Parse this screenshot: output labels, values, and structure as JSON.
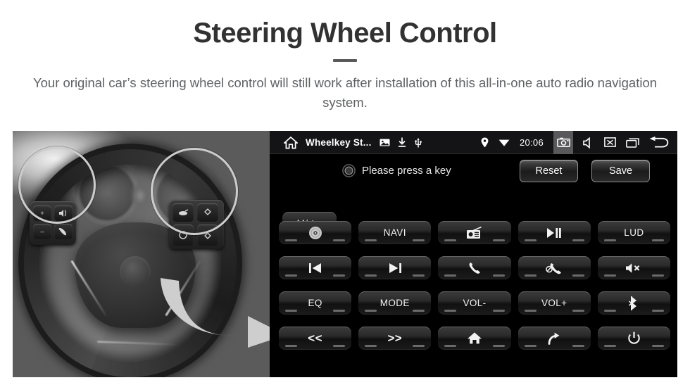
{
  "header": {
    "title": "Steering Wheel Control",
    "subtitle": "Your original car’s steering wheel control will still work after installation of this all-in-one auto radio navigation system."
  },
  "colors": {
    "accent_yellow": "#F6D02E",
    "arrow_yellow": "#F5D230",
    "title_text": "#323232",
    "subtitle_text": "#5f6163",
    "panel_background": "#000000",
    "statusbar_background": "#141416",
    "button_text": "#f2f2f2",
    "camera_highlight": "#59595c"
  },
  "photo": {
    "description": "grayscale-steering-wheel-photo",
    "left_pad_keys": [
      "+",
      "−",
      "voice-icon",
      "phone-icon"
    ],
    "right_pad_keys": [
      "media-icon",
      "up-arrow-icon",
      "circle-icon",
      "down-arrow-icon"
    ],
    "highlights": [
      "left-control-pad-highlight",
      "right-control-pad-highlight"
    ],
    "arrow": "curved-right-arrow"
  },
  "head_unit": {
    "statusbar": {
      "home_icon": "home-icon",
      "app_title": "Wheelkey St...",
      "left_icons": [
        "image-icon",
        "download-icon",
        "usb-icon"
      ],
      "right_icons_before_clock": [
        "location-pin-icon",
        "wifi-icon"
      ],
      "clock": "20:06",
      "right_icons": [
        "camera-icon",
        "speaker-icon",
        "screen-off-icon",
        "recents-icon",
        "back-icon"
      ]
    },
    "hint": {
      "icon": "record-circle-icon",
      "text": "Please press a key"
    },
    "actions": {
      "reset_label": "Reset",
      "save_label": "Save"
    },
    "mode_mute_button": {
      "label": "M/",
      "icon": "mute-icon"
    },
    "keys": [
      {
        "name": "disc",
        "label": "",
        "icon": "disc-icon"
      },
      {
        "name": "navi",
        "label": "NAVI",
        "icon": ""
      },
      {
        "name": "radio",
        "label": "",
        "icon": "radio-icon"
      },
      {
        "name": "play-pause",
        "label": "",
        "icon": "play-pause-icon"
      },
      {
        "name": "lud",
        "label": "LUD",
        "icon": ""
      },
      {
        "name": "previous",
        "label": "",
        "icon": "previous-track-icon"
      },
      {
        "name": "next",
        "label": "",
        "icon": "next-track-icon"
      },
      {
        "name": "answer-call",
        "label": "",
        "icon": "phone-answer-icon"
      },
      {
        "name": "end-call",
        "label": "",
        "icon": "phone-hangup-icon"
      },
      {
        "name": "mute",
        "label": "",
        "icon": "mute-icon"
      },
      {
        "name": "eq",
        "label": "EQ",
        "icon": ""
      },
      {
        "name": "mode",
        "label": "MODE",
        "icon": ""
      },
      {
        "name": "volume-down",
        "label": "VOL-",
        "icon": ""
      },
      {
        "name": "volume-up",
        "label": "VOL+",
        "icon": ""
      },
      {
        "name": "bluetooth",
        "label": "",
        "icon": "bluetooth-icon"
      },
      {
        "name": "seek-back",
        "label": "<<",
        "icon": ""
      },
      {
        "name": "seek-forward",
        "label": ">>",
        "icon": ""
      },
      {
        "name": "home",
        "label": "",
        "icon": "home-filled-icon"
      },
      {
        "name": "redo",
        "label": "",
        "icon": "redo-icon"
      },
      {
        "name": "power",
        "label": "",
        "icon": "power-icon"
      }
    ]
  }
}
